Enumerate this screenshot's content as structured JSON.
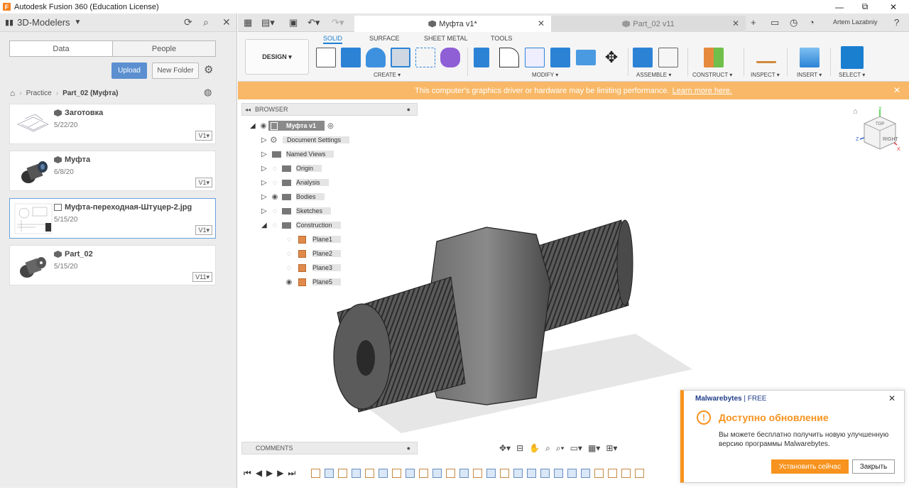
{
  "window": {
    "title": "Autodesk Fusion 360 (Education License)",
    "app_icon": "F",
    "minimize": "—",
    "restore": "⧉",
    "close": "✕"
  },
  "data_panel": {
    "team": "3D-Modelers",
    "tabs": [
      "Data",
      "People"
    ],
    "upload_label": "Upload",
    "new_folder_label": "New Folder",
    "breadcrumb": [
      "Practice",
      "Part_02 (Муфта)"
    ],
    "files": [
      {
        "name": "Заготовка",
        "date": "5/22/20",
        "version": "V1"
      },
      {
        "name": "Муфта",
        "date": "6/8/20",
        "version": "V1"
      },
      {
        "name": "Муфта-переходная-Штуцер-2.jpg",
        "date": "5/15/20",
        "version": "V1"
      },
      {
        "name": "Part_02",
        "date": "5/15/20",
        "version": "V11"
      }
    ]
  },
  "doc_tabs": [
    {
      "label": "Муфта v1*",
      "active": true
    },
    {
      "label": "Part_02 v11",
      "active": false
    }
  ],
  "user": {
    "name": "Artem Lazabniy"
  },
  "toolbar": {
    "workspace": "DESIGN",
    "subtabs": [
      "SOLID",
      "SURFACE",
      "SHEET METAL",
      "TOOLS"
    ],
    "groups": [
      "CREATE",
      "MODIFY",
      "ASSEMBLE",
      "CONSTRUCT",
      "INSPECT",
      "INSERT",
      "SELECT"
    ]
  },
  "warning": {
    "text": "This computer's graphics driver or hardware may be limiting performance.",
    "link": "Learn more here."
  },
  "browser": {
    "title": "BROWSER",
    "root": "Муфта v1",
    "items": [
      "Document Settings",
      "Named Views",
      "Origin",
      "Analysis",
      "Bodies",
      "Sketches",
      "Construction"
    ],
    "planes": [
      "Plane1",
      "Plane2",
      "Plane3",
      "Plane5"
    ]
  },
  "viewcube": {
    "top": "TOP",
    "right": "RIGHT",
    "axis_x": "X",
    "axis_y": "Y",
    "axis_z": "Z"
  },
  "comments_label": "COMMENTS",
  "notification": {
    "brand": "Malwarebytes",
    "edition": "| FREE",
    "title": "Доступно обновление",
    "message": "Вы можете бесплатно получить новую улучшенную версию программы Malwarebytes.",
    "install_label": "Установить сейчас",
    "close_label": "Закрыть"
  },
  "colors": {
    "accent": "#1b7fd0",
    "warning_bar": "#f9b867",
    "malwarebytes_orange": "#f7931e",
    "upload_blue": "#5b8fd0"
  }
}
